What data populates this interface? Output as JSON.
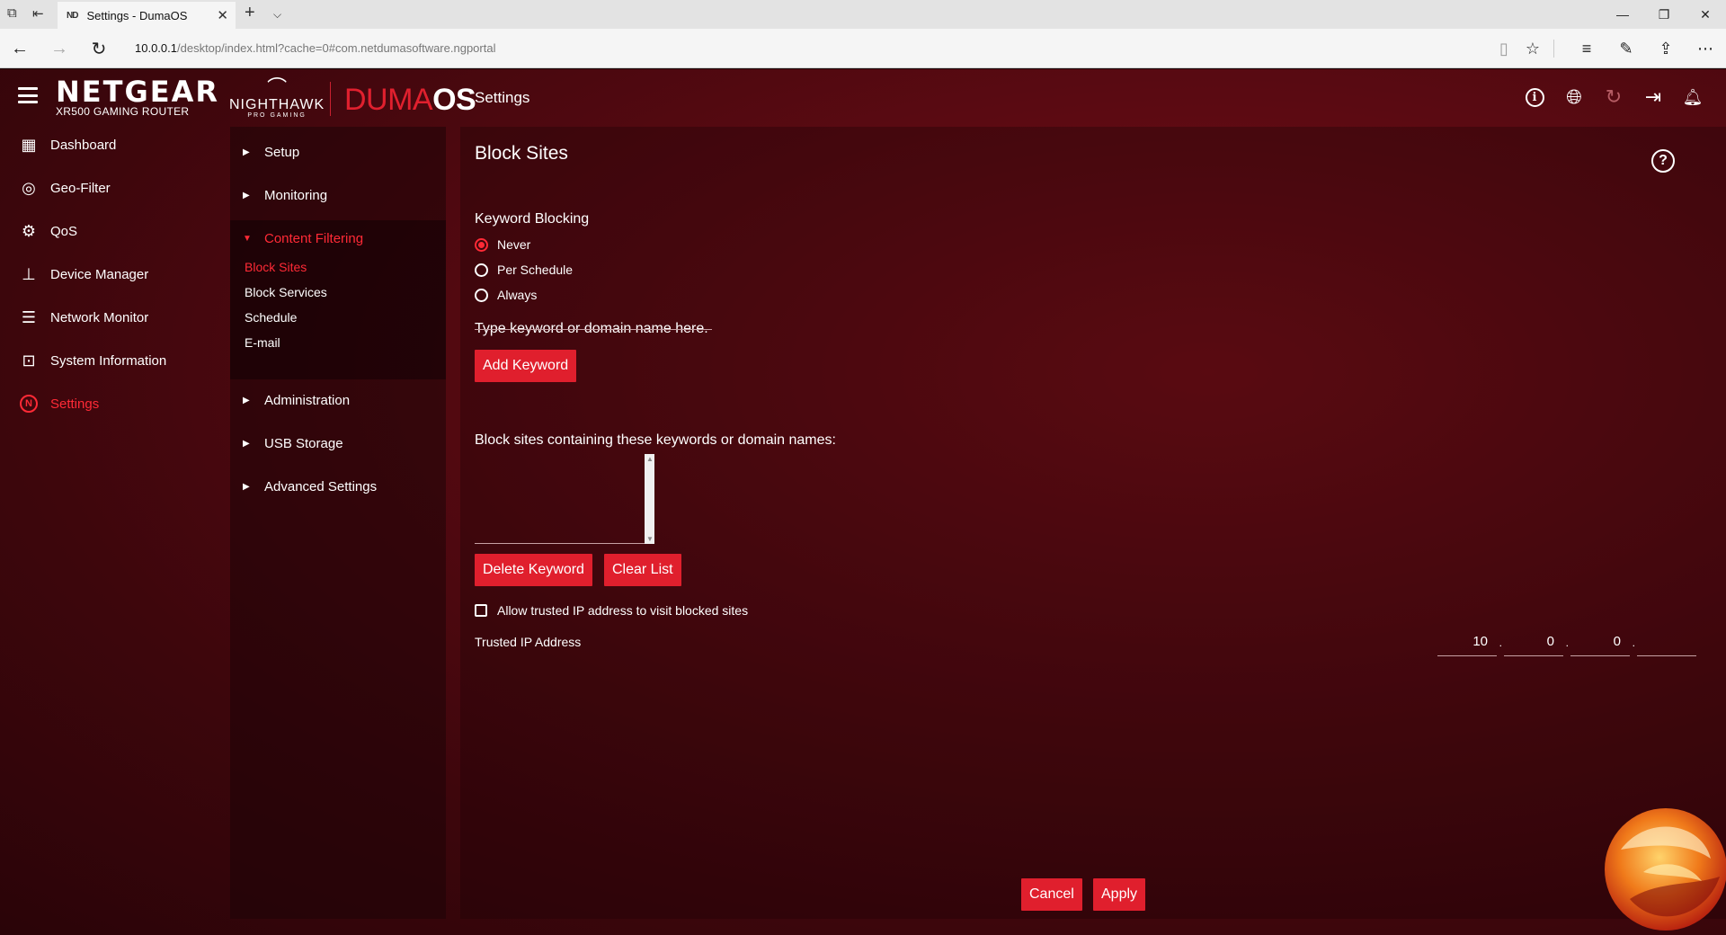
{
  "browser": {
    "tab_title": "Settings - DumaOS",
    "tab_favicon": "ND",
    "url_host": "10.0.0.1",
    "url_path": "/desktop/index.html?cache=0#com.netdumasoftware.ngportal"
  },
  "header": {
    "brand_name": "NETGEAR",
    "brand_sub": "XR500 GAMING ROUTER",
    "nighthawk": "NIGHTHAWK",
    "nighthawk_sub": "PRO GAMING",
    "duma": "DUMA",
    "os": "OS",
    "title": "Settings"
  },
  "leftnav": {
    "items": [
      {
        "label": "Dashboard",
        "icon": "dashboard-icon"
      },
      {
        "label": "Geo-Filter",
        "icon": "geo-filter-icon"
      },
      {
        "label": "QoS",
        "icon": "qos-icon"
      },
      {
        "label": "Device Manager",
        "icon": "device-manager-icon"
      },
      {
        "label": "Network Monitor",
        "icon": "network-monitor-icon"
      },
      {
        "label": "System Information",
        "icon": "system-information-icon"
      },
      {
        "label": "Settings",
        "icon": "settings-n-icon"
      }
    ],
    "active_color": "#ff2a36"
  },
  "subnav": {
    "setup": "Setup",
    "monitoring": "Monitoring",
    "content_filtering": "Content Filtering",
    "sub_items": [
      "Block Sites",
      "Block Services",
      "Schedule",
      "E-mail"
    ],
    "administration": "Administration",
    "usb_storage": "USB Storage",
    "advanced_settings": "Advanced Settings"
  },
  "main": {
    "title": "Block Sites",
    "keyword_blocking_label": "Keyword Blocking",
    "radio_options": [
      "Never",
      "Per Schedule",
      "Always"
    ],
    "selected_option": "Never",
    "keyword_prompt": "Type keyword or domain name here.",
    "keyword_value": "",
    "add_keyword": "Add Keyword",
    "list_label": "Block sites containing these keywords or domain names:",
    "delete_keyword": "Delete Keyword",
    "clear_list": "Clear List",
    "trusted_checkbox_label": "Allow trusted IP address to visit blocked sites",
    "trusted_checkbox_checked": false,
    "trusted_ip_label": "Trusted IP Address",
    "ip_octets": [
      "10",
      "0",
      "0",
      ""
    ],
    "cancel": "Cancel",
    "apply": "Apply",
    "accent_color": "#e01f2d"
  }
}
